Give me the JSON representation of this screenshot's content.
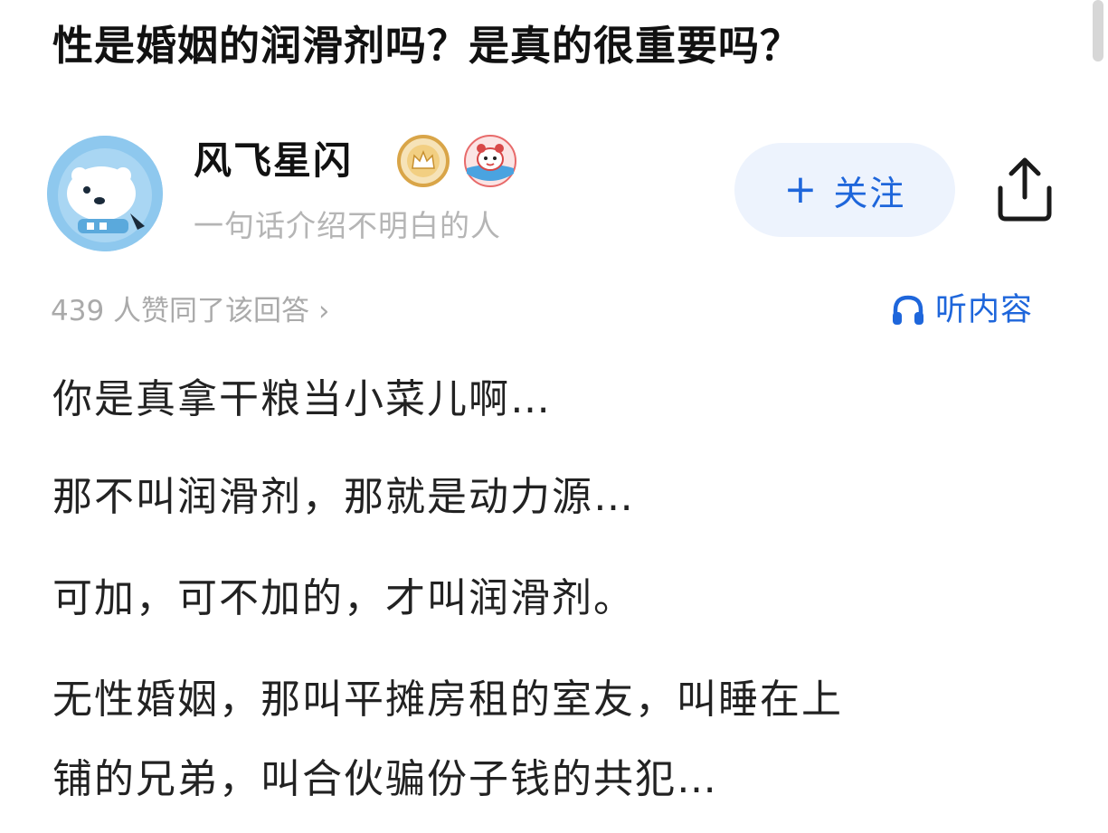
{
  "question": {
    "title": "性是婚姻的润滑剂吗？是真的很重要吗？"
  },
  "author": {
    "name": "风飞星闪",
    "bio": "一句话介绍不明白的人",
    "avatar_icon": "polar-bear-avatar",
    "badges": [
      "crown-badge-icon",
      "pet-badge-icon"
    ]
  },
  "actions": {
    "follow_plus": "+",
    "follow_label": "关注",
    "share_icon": "share-icon",
    "listen_icon": "headphones-icon",
    "listen_label": "听内容"
  },
  "votes": {
    "text": "439 人赞同了该回答",
    "chevron": "›"
  },
  "answer": {
    "paragraphs": [
      "你是真拿干粮当小菜儿啊…",
      "那不叫润滑剂，那就是动力源…",
      "可加，可不加的，才叫润滑剂。",
      "无性婚姻，那叫平摊房租的室友，叫睡在上",
      "铺的兄弟，叫合伙骗份子钱的共犯…"
    ]
  },
  "colors": {
    "accent": "#1e66db",
    "follow_bg": "#edf3fd",
    "muted_text": "#b5b5b5",
    "avatar_bg": "#8ec8ee",
    "crown_gold": "#d9a548"
  }
}
